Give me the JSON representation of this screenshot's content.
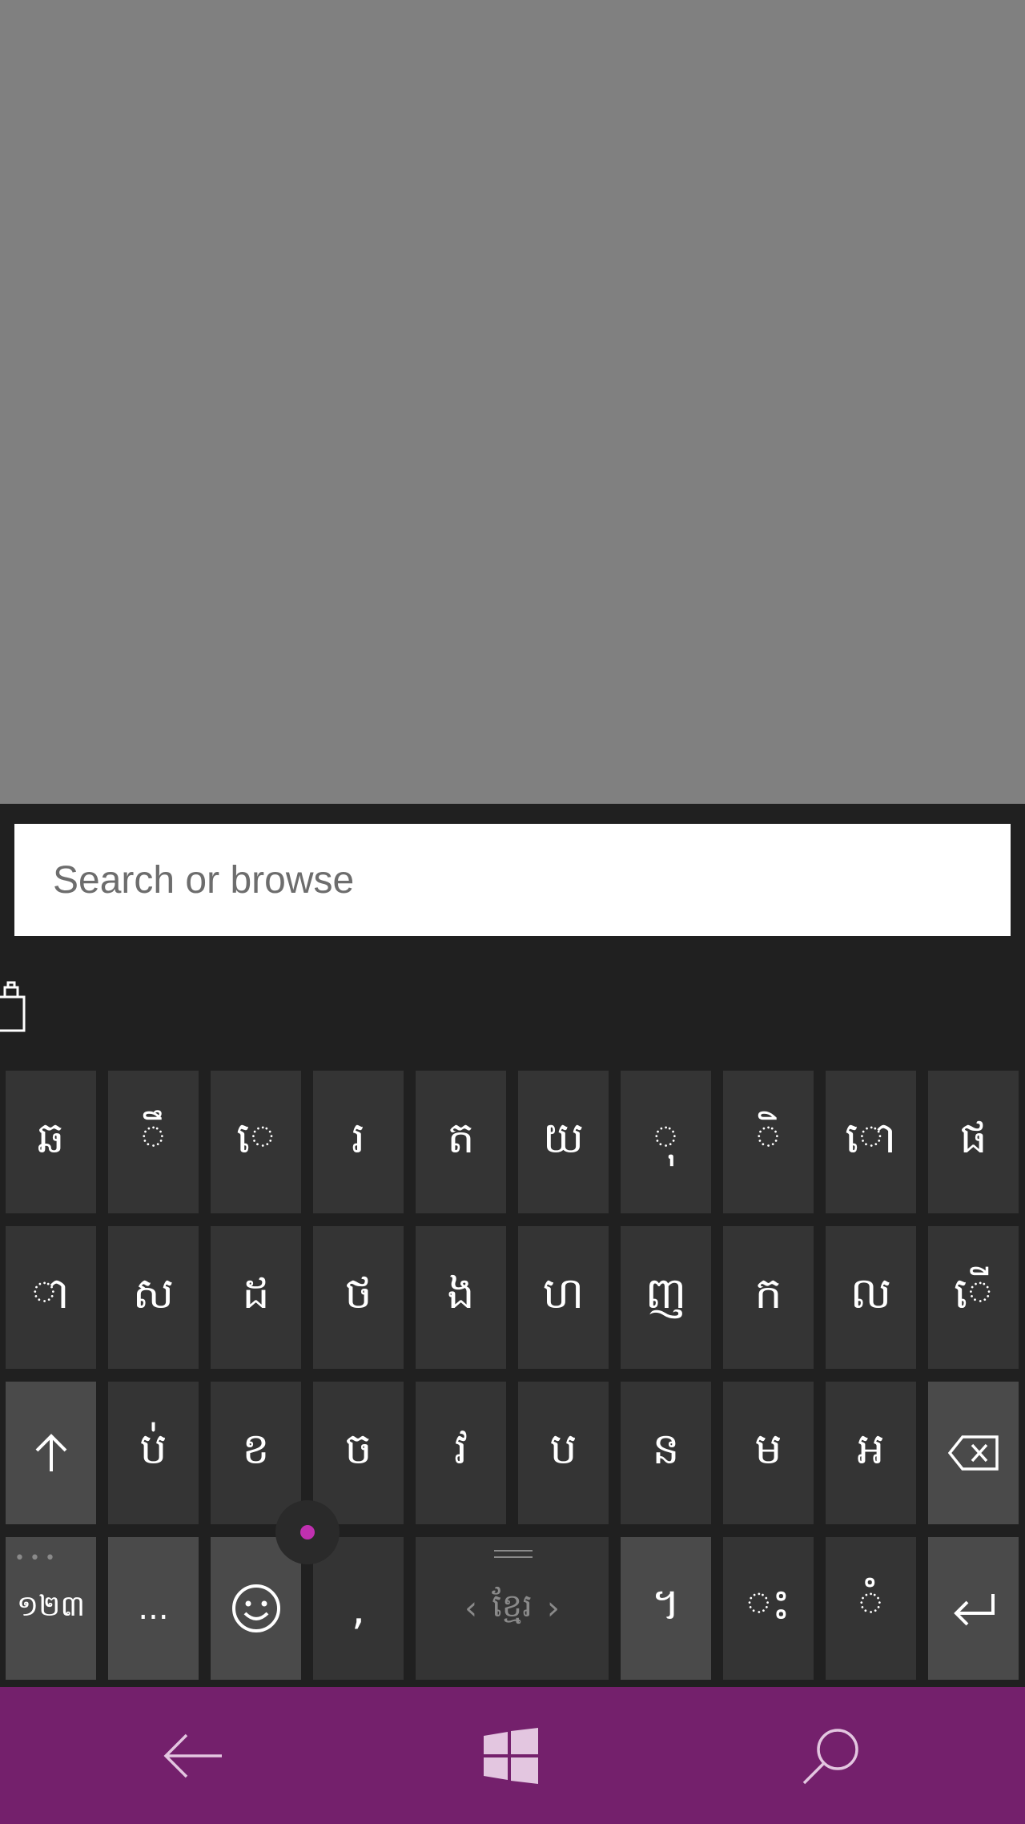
{
  "search": {
    "placeholder": "Search or browse",
    "value": ""
  },
  "keyboard": {
    "row1": [
      "ឆ",
      "ឹ",
      "េ",
      "រ",
      "ត",
      "យ",
      "ុ",
      "ិ",
      "ោ",
      "ផ"
    ],
    "row2": [
      "ា",
      "ស",
      "ដ",
      "ថ",
      "ង",
      "ហ",
      "ញ",
      "ក",
      "ល",
      "ើ"
    ],
    "row3": [
      "ប់",
      "ខ",
      "ច",
      "វ",
      "ប",
      "ន",
      "ម",
      "អ"
    ],
    "bottom": {
      "numbers": "១២៣",
      "more": "...",
      "comma": ",",
      "language": "ខ្មែរ",
      "khmer_key": "។",
      "visarga": "ះ",
      "nikahit": "ំ"
    },
    "shift_icon": "up-arrow-icon",
    "backspace_icon": "backspace-icon",
    "enter_icon": "enter-icon",
    "emoji_icon": "smiley-icon",
    "cursor_color": "#c030b0"
  },
  "navbar": {
    "color": "#74206c",
    "icons": [
      "back-arrow-icon",
      "windows-logo-icon",
      "search-icon"
    ]
  }
}
